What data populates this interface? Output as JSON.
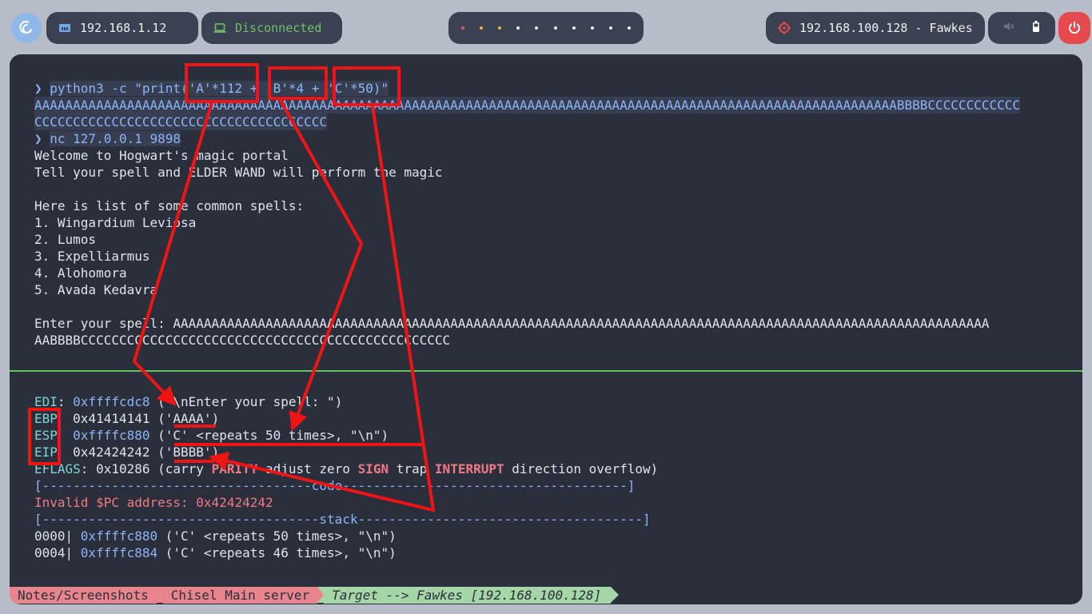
{
  "topbar": {
    "host_ip": "192.168.1.12",
    "vpn_status": "Disconnected",
    "target": "192.168.100.128 - Fawkes",
    "icons": [
      "debian-logo-icon",
      "ethernet-icon",
      "laptop-icon",
      "target-icon",
      "mute-icon",
      "battery-icon",
      "power-icon"
    ]
  },
  "terminal": {
    "cmd1_prompt": "❯ ",
    "cmd1": "python3 -c \"print('A'*112 + 'B'*4 + 'C'*50)\"",
    "out1_a": "AAAAAAAAAAAAAAAAAAAAAAAAAAAAAAAAAAAAAAAAAAAAAAAAAAAAAAAAAAAAAAAAAAAAAAAAAAAAAAAAAAAAAAAAAAAAAAAAAAAAAAAAAAAAAAAABBBBCCCCCCCCCCCC",
    "out1_b": "CCCCCCCCCCCCCCCCCCCCCCCCCCCCCCCCCCCCCC",
    "cmd2_prompt": "❯ ",
    "cmd2": "nc 127.0.0.1 9898",
    "welcome": "Welcome to Hogwart's magic portal",
    "tell": "Tell your spell and ELDER WAND will perform the magic",
    "list_header": "Here is list of some common spells:",
    "spells": [
      "1. Wingardium Leviosa",
      "2. Lumos",
      "3. Expelliarmus",
      "4. Alohomora",
      "5. Avada Kedavra"
    ],
    "enter_label": "Enter your spell: ",
    "enter_a": "AAAAAAAAAAAAAAAAAAAAAAAAAAAAAAAAAAAAAAAAAAAAAAAAAAAAAAAAAAAAAAAAAAAAAAAAAAAAAAAAAAAAAAAAAAAAAAAAAAAAAAAAAA",
    "enter_b": "AABBBBCCCCCCCCCCCCCCCCCCCCCCCCCCCCCCCCCCCCCCCCCCCCCCCC"
  },
  "gdb": {
    "edi": {
      "name": "EDI",
      "value": "0xffffcdc8",
      "desc": " (\"\\nEnter your spell: \")"
    },
    "ebp": {
      "name": "EBP",
      "value": "0x41414141",
      "desc": " ('AAAA')"
    },
    "esp": {
      "name": "ESP",
      "value": "0xffffc880",
      "desc": " ('C' <repeats 50 times>, \"\\n\")"
    },
    "eip": {
      "name": "EIP",
      "value": "0x42424242",
      "desc": " ('BBBB')"
    },
    "eflags": {
      "name": "EFLAGS",
      "value": "0x10286",
      "open": " (carry ",
      "parity": "PARITY",
      " adjust": " adjust zero ",
      "sign": "SIGN",
      " trap": " trap ",
      "interrupt": "INTERRUPT",
      "close": " direction overflow)"
    },
    "code_sep": "[-----------------------------------code-------------------------------------]",
    "invalid_pc": "Invalid $PC address: 0x42424242",
    "stack_sep": "[------------------------------------stack-------------------------------------]",
    "stack": [
      {
        "off": "0000| ",
        "addr": "0xffffc880",
        "desc": " ('C' <repeats 50 times>, \"\\n\")"
      },
      {
        "off": "0004| ",
        "addr": "0xffffc884",
        "desc": " ('C' <repeats 46 times>, \"\\n\")"
      }
    ]
  },
  "statusbar": {
    "path": "Notes/Screenshots",
    "session": "Chisel Main server",
    "target": "Target --> Fawkes [192.168.100.128]"
  },
  "colors": {
    "annotation": "#f01414",
    "prompt": "#8db5f5",
    "register": "#7ed4d8",
    "error": "#ee7a86",
    "divider": "#65c466"
  }
}
